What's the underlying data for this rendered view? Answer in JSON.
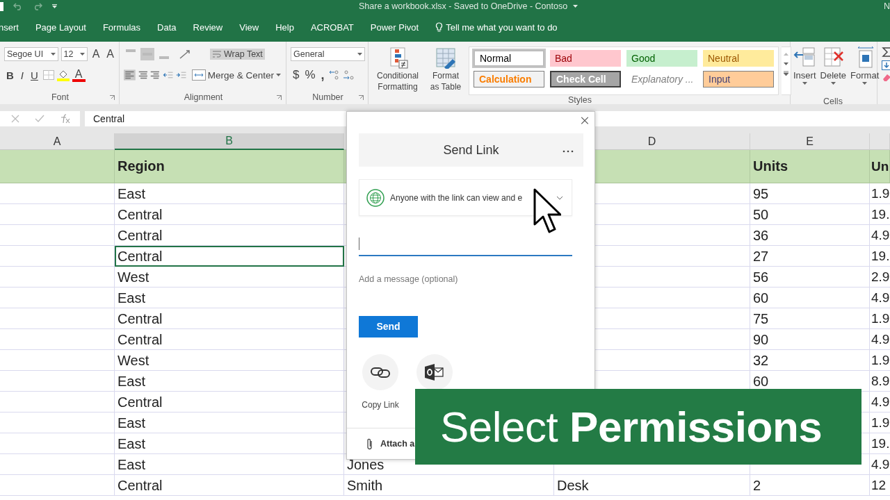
{
  "title_bar": {
    "title": "Share a workbook.xlsx  -  Saved to OneDrive - Contoso",
    "user": "N"
  },
  "ribbon_tabs": [
    {
      "label": "nsert",
      "selected": false
    },
    {
      "label": "Page Layout",
      "selected": false
    },
    {
      "label": "Formulas",
      "selected": false
    },
    {
      "label": "Data",
      "selected": false
    },
    {
      "label": "Review",
      "selected": false
    },
    {
      "label": "View",
      "selected": false
    },
    {
      "label": "Help",
      "selected": false
    },
    {
      "label": "ACROBAT",
      "selected": false
    },
    {
      "label": "Power Pivot",
      "selected": false
    }
  ],
  "tell_me": "Tell me what you want to do",
  "ribbon": {
    "font": {
      "label": "Font",
      "name": "Segoe UI",
      "size": "12",
      "grow": "A",
      "shrink": "A",
      "bold": "B",
      "italic": "I",
      "underline": "U",
      "font_fg": "A"
    },
    "alignment": {
      "label": "Alignment",
      "wrap_text": "Wrap Text",
      "wrap_on": true,
      "middle_on": true,
      "left_on": true,
      "merge": "Merge & Center"
    },
    "number": {
      "label": "Number",
      "format": "General",
      "currency": "$",
      "percent": "%",
      "comma": ","
    },
    "styles": {
      "label": "Styles",
      "conditional": "Conditional Formatting",
      "format_table": "Format as Table",
      "gallery": [
        {
          "label": "Normal",
          "kind": "normal",
          "selected": true
        },
        {
          "label": "Bad",
          "kind": "bad",
          "selected": false
        },
        {
          "label": "Good",
          "kind": "good",
          "selected": false
        },
        {
          "label": "Neutral",
          "kind": "neutral",
          "selected": false
        },
        {
          "label": "Calculation",
          "kind": "calculation",
          "selected": false
        },
        {
          "label": "Check Cell",
          "kind": "check",
          "selected": false
        },
        {
          "label": "Explanatory ...",
          "kind": "explanatory",
          "selected": false
        },
        {
          "label": "Input",
          "kind": "input",
          "selected": false
        }
      ]
    },
    "cells": {
      "label": "Cells",
      "buttons": [
        "Insert",
        "Delete",
        "Format"
      ]
    }
  },
  "formula_bar": {
    "value": "Central"
  },
  "columns": [
    {
      "label": "A",
      "selected": false
    },
    {
      "label": "B",
      "selected": true,
      "heading": "Region"
    },
    {
      "selected": false
    },
    {
      "label": "D",
      "selected": false
    },
    {
      "label": "E",
      "selected": false,
      "heading": "Units"
    },
    {
      "selected": false,
      "heading": "Un"
    }
  ],
  "rows": [
    {
      "selected": false,
      "cells": [
        {},
        {
          "text": "East"
        },
        {},
        {},
        {
          "text": "95"
        },
        {
          "text": "1.9"
        }
      ]
    },
    {
      "selected": false,
      "cells": [
        {},
        {
          "text": "Central"
        },
        {},
        {},
        {
          "text": "50"
        },
        {
          "text": "19."
        }
      ]
    },
    {
      "selected": false,
      "cells": [
        {},
        {
          "text": "Central"
        },
        {},
        {},
        {
          "text": "36"
        },
        {
          "text": "4.9"
        }
      ]
    },
    {
      "selected": true,
      "cells": [
        {},
        {
          "text": "Central"
        },
        {},
        {},
        {
          "text": "27"
        },
        {
          "text": "19."
        }
      ]
    },
    {
      "selected": false,
      "cells": [
        {},
        {
          "text": "West"
        },
        {},
        {},
        {
          "text": "56"
        },
        {
          "text": "2.9"
        }
      ]
    },
    {
      "selected": false,
      "cells": [
        {},
        {
          "text": "East"
        },
        {},
        {},
        {
          "text": "60"
        },
        {
          "text": "4.9"
        }
      ]
    },
    {
      "selected": false,
      "cells": [
        {},
        {
          "text": "Central"
        },
        {},
        {},
        {
          "text": "75"
        },
        {
          "text": "1.9"
        }
      ]
    },
    {
      "selected": false,
      "cells": [
        {},
        {
          "text": "Central"
        },
        {},
        {},
        {
          "text": "90"
        },
        {
          "text": "4.9"
        }
      ]
    },
    {
      "selected": false,
      "cells": [
        {},
        {
          "text": "West"
        },
        {},
        {},
        {
          "text": "32"
        },
        {
          "text": "1.9"
        }
      ]
    },
    {
      "selected": false,
      "cells": [
        {},
        {
          "text": "East"
        },
        {},
        {},
        {
          "text": "60"
        },
        {
          "text": "8.9"
        }
      ]
    },
    {
      "selected": false,
      "cells": [
        {},
        {
          "text": "Central"
        },
        {},
        {},
        {},
        {
          "text": "4.9"
        }
      ]
    },
    {
      "selected": false,
      "cells": [
        {},
        {
          "text": "East"
        },
        {},
        {},
        {},
        {
          "text": "1.9"
        }
      ]
    },
    {
      "selected": false,
      "cells": [
        {},
        {
          "text": "East"
        },
        {},
        {},
        {},
        {
          "text": "19."
        }
      ]
    },
    {
      "selected": false,
      "cells": [
        {},
        {
          "text": "East"
        },
        {
          "text": "Jones"
        },
        {},
        {},
        {
          "text": "4.9"
        }
      ]
    },
    {
      "selected": false,
      "cells": [
        {},
        {
          "text": "Central"
        },
        {
          "text": "Smith"
        },
        {
          "text": "Desk"
        },
        {
          "text": "2"
        },
        {
          "text": "12"
        }
      ]
    }
  ],
  "dialog": {
    "title": "Send Link",
    "permission": "Anyone with the link can view and e",
    "message_placeholder": "Add a message (optional)",
    "send": "Send",
    "share_options": [
      {
        "kind": "link",
        "label": "Copy Link"
      },
      {
        "kind": "outlook"
      }
    ],
    "attach": "Attach a"
  },
  "banner": {
    "text": "Select **Permissions**"
  }
}
